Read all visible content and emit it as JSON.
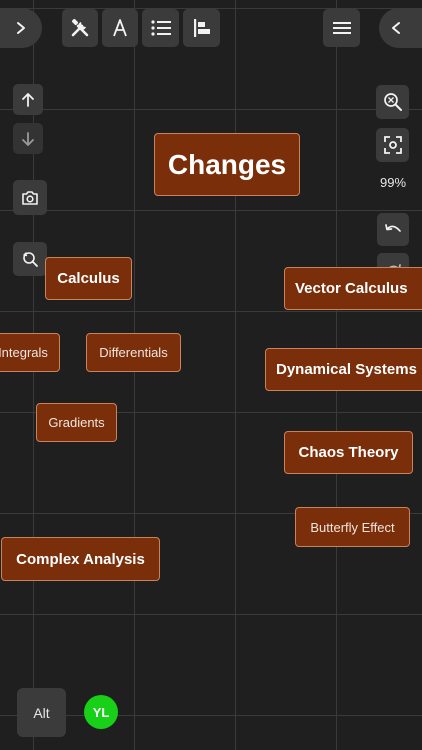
{
  "toolbar": {
    "icons": [
      "tools-icon",
      "text-icon",
      "list-icon",
      "align-left-icon",
      "menu-icon"
    ]
  },
  "zoom_level": "99%",
  "nodes": {
    "changes": "Changes",
    "calculus": "Calculus",
    "vector_calculus": "Vector Calculus",
    "integrals": "Integrals",
    "differentials": "Differentials",
    "dynamical_systems": "Dynamical Systems",
    "gradients": "Gradients",
    "chaos_theory": "Chaos Theory",
    "butterfly_effect": "Butterfly Effect",
    "complex_analysis": "Complex Analysis"
  },
  "bottom": {
    "alt_label": "Alt",
    "avatar_initials": "YL",
    "avatar_color": "#17d017"
  },
  "colors": {
    "node_fill": "#7a2e0a",
    "node_border": "#c9825a",
    "background": "#1f1f1f"
  }
}
